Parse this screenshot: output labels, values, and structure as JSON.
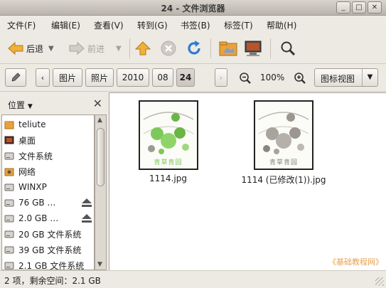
{
  "window": {
    "title": "24 - 文件浏览器"
  },
  "window_buttons": {
    "minimize": "_",
    "maximize": "□",
    "close": "✕"
  },
  "menu": [
    {
      "label": "文件(F)"
    },
    {
      "label": "编辑(E)"
    },
    {
      "label": "查看(V)"
    },
    {
      "label": "转到(G)"
    },
    {
      "label": "书签(B)"
    },
    {
      "label": "标签(T)"
    },
    {
      "label": "帮助(H)"
    }
  ],
  "toolbar": {
    "back": "后退",
    "forward": "前进"
  },
  "pathbar": {
    "segments": [
      {
        "label": "图片"
      },
      {
        "label": "照片"
      },
      {
        "label": "2010"
      },
      {
        "label": "08"
      },
      {
        "label": "24"
      }
    ],
    "active": "24"
  },
  "zoom": {
    "level": "100%"
  },
  "view_mode": {
    "selected": "图标视图"
  },
  "sidebar": {
    "title": "位置",
    "items": [
      {
        "label": "teliute",
        "icon": "home-folder-icon"
      },
      {
        "label": "桌面",
        "icon": "desktop-icon"
      },
      {
        "label": "文件系统",
        "icon": "drive-icon"
      },
      {
        "label": "网络",
        "icon": "network-icon"
      },
      {
        "label": "WINXP",
        "icon": "drive-icon"
      },
      {
        "label": "76 GB …",
        "icon": "drive-icon",
        "eject": true
      },
      {
        "label": "2.0 GB …",
        "icon": "drive-icon",
        "eject": true
      },
      {
        "label": "20 GB 文件系统",
        "icon": "drive-icon"
      },
      {
        "label": "39 GB 文件系统",
        "icon": "drive-icon"
      },
      {
        "label": "2.1 GB 文件系统",
        "icon": "drive-icon"
      }
    ]
  },
  "files": [
    {
      "name": "1114.jpg",
      "thumb_text": "青草青园",
      "tint": "#7dc85a"
    },
    {
      "name": "1114 (已修改(1)).jpg",
      "thumb_text": "青草青园",
      "tint": "#9a9a9a"
    }
  ],
  "watermark": "《基础教程网》",
  "status": {
    "text": "2 项，剩余空间：2.1 GB"
  }
}
